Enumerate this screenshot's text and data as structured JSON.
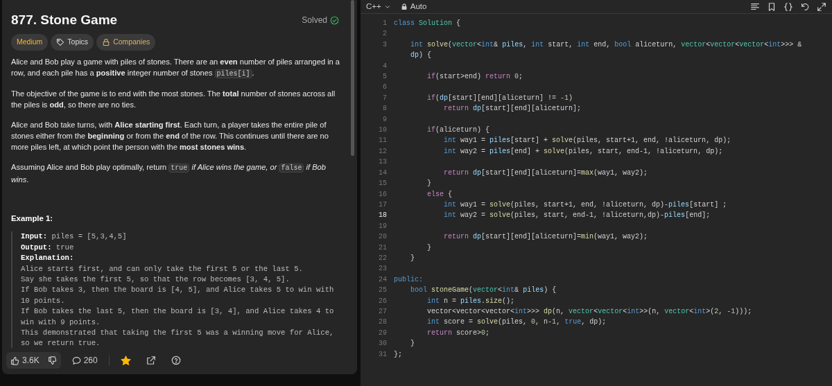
{
  "problem": {
    "title": "877. Stone Game",
    "status": "Solved",
    "solved": true,
    "tags": [
      {
        "label": "Medium",
        "kind": "difficulty"
      },
      {
        "label": "Topics",
        "kind": "topics"
      },
      {
        "label": "Companies",
        "kind": "companies"
      }
    ],
    "paragraphs": [
      [
        {
          "kind": "text",
          "text": "Alice and Bob play a game with piles of stones. There are an **even** number of piles arranged in a row, and each pile has a **positive** integer number of stones "
        },
        {
          "kind": "code",
          "text": "piles[i]"
        },
        {
          "kind": "text",
          "text": "."
        }
      ],
      [
        {
          "kind": "text",
          "text": "The objective of the game is to end with the most stones. The **total** number of stones across all the piles is **odd**, so there are no ties."
        }
      ],
      [
        {
          "kind": "text",
          "text": "Alice and Bob take turns, with **Alice starting first**. Each turn, a player takes the entire pile of stones either from the **beginning** or from the **end** of the row. This continues until there are no more piles left, at which point the person with the **most stones wins**."
        }
      ],
      [
        {
          "kind": "text",
          "text": "Assuming Alice and Bob play optimally, return "
        },
        {
          "kind": "code",
          "text": "true"
        },
        {
          "kind": "text",
          "text": " *if Alice wins the game, or* "
        },
        {
          "kind": "code",
          "text": "false"
        },
        {
          "kind": "text",
          "text": " *if Bob wins*."
        }
      ]
    ],
    "example": {
      "title": "Example 1:",
      "fields": [
        {
          "label": "Input:",
          "value": "piles = [5,3,4,5]"
        },
        {
          "label": "Output:",
          "value": "true"
        }
      ],
      "explanation_label": "Explanation:",
      "explanation_lines": [
        "Alice starts first, and can only take the first 5 or the last 5.",
        "Say she takes the first 5, so that the row becomes [3, 4, 5].",
        "If Bob takes 3, then the board is [4, 5], and Alice takes 5 to win with 10 points.",
        "If Bob takes the last 5, then the board is [3, 4], and Alice takes 4 to win with 9 points.",
        "This demonstrated that taking the first 5 was a winning move for Alice, so we return true."
      ]
    },
    "actions": {
      "likes": "3.6K",
      "comments": "260",
      "favorited": true
    }
  },
  "editor": {
    "language": "C++",
    "mode": "Auto",
    "lines": [
      {
        "no": "1",
        "active": false,
        "segs": [
          {
            "kind": "keyword",
            "text": "class "
          },
          {
            "kind": "type",
            "text": "Solution"
          },
          {
            "kind": "plain",
            "text": " {"
          }
        ]
      },
      {
        "no": "2",
        "active": false
      },
      {
        "no": "3",
        "active": false,
        "segs": [
          {
            "kind": "keyword",
            "text": "    int "
          },
          {
            "kind": "function",
            "text": "solve"
          },
          {
            "kind": "plain",
            "text": "("
          },
          {
            "kind": "type",
            "text": "vector"
          },
          {
            "kind": "plain",
            "text": "<"
          },
          {
            "kind": "keyword",
            "text": "int"
          },
          {
            "kind": "plain",
            "text": "& "
          },
          {
            "kind": "variable",
            "text": "piles"
          },
          {
            "kind": "plain",
            "text": ", "
          },
          {
            "kind": "keyword",
            "text": "int"
          },
          {
            "kind": "plain",
            "text": " start, "
          },
          {
            "kind": "keyword",
            "text": "int"
          },
          {
            "kind": "plain",
            "text": " end, "
          },
          {
            "kind": "keyword",
            "text": "bool"
          },
          {
            "kind": "plain",
            "text": " aliceturn, "
          },
          {
            "kind": "type",
            "text": "vector"
          },
          {
            "kind": "plain",
            "text": "<"
          },
          {
            "kind": "type",
            "text": "vector"
          },
          {
            "kind": "plain",
            "text": "<"
          },
          {
            "kind": "type",
            "text": "vector"
          },
          {
            "kind": "plain",
            "text": "<"
          },
          {
            "kind": "keyword",
            "text": "int"
          },
          {
            "kind": "plain",
            "text": ">>> & "
          },
          {
            "kind": "variable",
            "text": "dp"
          },
          {
            "kind": "plain",
            "text": ") {"
          }
        ]
      },
      {
        "no": "4",
        "active": false
      },
      {
        "no": "5",
        "active": false,
        "segs": [
          {
            "kind": "control",
            "text": "        if"
          },
          {
            "kind": "plain",
            "text": "(start>end) "
          },
          {
            "kind": "control",
            "text": "return "
          },
          {
            "kind": "number",
            "text": "0"
          },
          {
            "kind": "plain",
            "text": ";"
          }
        ]
      },
      {
        "no": "6",
        "active": false
      },
      {
        "no": "7",
        "active": false,
        "segs": [
          {
            "kind": "control",
            "text": "        if"
          },
          {
            "kind": "plain",
            "text": "("
          },
          {
            "kind": "variable",
            "text": "dp"
          },
          {
            "kind": "plain",
            "text": "[start][end][aliceturn] != "
          },
          {
            "kind": "number",
            "text": "-1"
          },
          {
            "kind": "plain",
            "text": ")"
          }
        ]
      },
      {
        "no": "8",
        "active": false,
        "segs": [
          {
            "kind": "control",
            "text": "            return "
          },
          {
            "kind": "variable",
            "text": "dp"
          },
          {
            "kind": "plain",
            "text": "[start][end][aliceturn];"
          }
        ]
      },
      {
        "no": "9",
        "active": false
      },
      {
        "no": "10",
        "active": false,
        "segs": [
          {
            "kind": "control",
            "text": "        if"
          },
          {
            "kind": "plain",
            "text": "(aliceturn) {"
          }
        ]
      },
      {
        "no": "11",
        "active": false,
        "segs": [
          {
            "kind": "keyword",
            "text": "            int"
          },
          {
            "kind": "plain",
            "text": " way1 = "
          },
          {
            "kind": "variable",
            "text": "piles"
          },
          {
            "kind": "plain",
            "text": "[start] + "
          },
          {
            "kind": "function",
            "text": "solve"
          },
          {
            "kind": "plain",
            "text": "(piles, start+1, end, !aliceturn, dp);"
          }
        ]
      },
      {
        "no": "12",
        "active": false,
        "segs": [
          {
            "kind": "keyword",
            "text": "            int"
          },
          {
            "kind": "plain",
            "text": " way2 = "
          },
          {
            "kind": "variable",
            "text": "piles"
          },
          {
            "kind": "plain",
            "text": "[end] + "
          },
          {
            "kind": "function",
            "text": "solve"
          },
          {
            "kind": "plain",
            "text": "(piles, start, end-1, !aliceturn, dp);"
          }
        ]
      },
      {
        "no": "13",
        "active": false
      },
      {
        "no": "14",
        "active": false,
        "segs": [
          {
            "kind": "control",
            "text": "            return "
          },
          {
            "kind": "variable",
            "text": "dp"
          },
          {
            "kind": "plain",
            "text": "[start][end][aliceturn]="
          },
          {
            "kind": "function",
            "text": "max"
          },
          {
            "kind": "plain",
            "text": "(way1, way2);"
          }
        ]
      },
      {
        "no": "15",
        "active": false,
        "segs": [
          {
            "kind": "plain",
            "text": "        }"
          }
        ]
      },
      {
        "no": "16",
        "active": false,
        "segs": [
          {
            "kind": "control",
            "text": "        else"
          },
          {
            "kind": "plain",
            "text": " {"
          }
        ]
      },
      {
        "no": "17",
        "active": false,
        "segs": [
          {
            "kind": "keyword",
            "text": "            int"
          },
          {
            "kind": "plain",
            "text": " way1 = "
          },
          {
            "kind": "function",
            "text": "solve"
          },
          {
            "kind": "plain",
            "text": "(piles, start+1, end, !aliceturn, dp)-"
          },
          {
            "kind": "variable",
            "text": "piles"
          },
          {
            "kind": "plain",
            "text": "[start] ;"
          }
        ]
      },
      {
        "no": "18",
        "active": true,
        "segs": [
          {
            "kind": "keyword",
            "text": "            int"
          },
          {
            "kind": "plain",
            "text": " way2 = "
          },
          {
            "kind": "function",
            "text": "solve"
          },
          {
            "kind": "plain",
            "text": "(piles, start, end-1, !aliceturn,dp)-"
          },
          {
            "kind": "variable",
            "text": "piles"
          },
          {
            "kind": "plain",
            "text": "[end];"
          }
        ]
      },
      {
        "no": "19",
        "active": false
      },
      {
        "no": "20",
        "active": false,
        "segs": [
          {
            "kind": "control",
            "text": "            return "
          },
          {
            "kind": "variable",
            "text": "dp"
          },
          {
            "kind": "plain",
            "text": "[start][end][aliceturn]="
          },
          {
            "kind": "function",
            "text": "min"
          },
          {
            "kind": "plain",
            "text": "(way1, way2);"
          }
        ]
      },
      {
        "no": "21",
        "active": false,
        "segs": [
          {
            "kind": "plain",
            "text": "        }"
          }
        ]
      },
      {
        "no": "22",
        "active": false,
        "segs": [
          {
            "kind": "plain",
            "text": "    }"
          }
        ]
      },
      {
        "no": "23",
        "active": false
      },
      {
        "no": "24",
        "active": false,
        "segs": [
          {
            "kind": "keyword",
            "text": "public:"
          }
        ]
      },
      {
        "no": "25",
        "active": false,
        "segs": [
          {
            "kind": "keyword",
            "text": "    bool "
          },
          {
            "kind": "function",
            "text": "stoneGame"
          },
          {
            "kind": "plain",
            "text": "("
          },
          {
            "kind": "type",
            "text": "vector"
          },
          {
            "kind": "plain",
            "text": "<"
          },
          {
            "kind": "keyword",
            "text": "int"
          },
          {
            "kind": "plain",
            "text": "& "
          },
          {
            "kind": "variable",
            "text": "piles"
          },
          {
            "kind": "plain",
            "text": ") {"
          }
        ]
      },
      {
        "no": "26",
        "active": false,
        "segs": [
          {
            "kind": "keyword",
            "text": "        int"
          },
          {
            "kind": "plain",
            "text": " n = "
          },
          {
            "kind": "variable",
            "text": "piles"
          },
          {
            "kind": "plain",
            "text": "."
          },
          {
            "kind": "function",
            "text": "size"
          },
          {
            "kind": "plain",
            "text": "();"
          }
        ]
      },
      {
        "no": "27",
        "active": false,
        "segs": [
          {
            "kind": "plain",
            "text": "        vector<vector<vector<"
          },
          {
            "kind": "keyword",
            "text": "int"
          },
          {
            "kind": "plain",
            "text": ">>> "
          },
          {
            "kind": "function",
            "text": "dp"
          },
          {
            "kind": "plain",
            "text": "(n, "
          },
          {
            "kind": "type",
            "text": "vector"
          },
          {
            "kind": "plain",
            "text": "<"
          },
          {
            "kind": "type",
            "text": "vector"
          },
          {
            "kind": "plain",
            "text": "<"
          },
          {
            "kind": "keyword",
            "text": "int"
          },
          {
            "kind": "plain",
            "text": ">>(n, "
          },
          {
            "kind": "type",
            "text": "vector"
          },
          {
            "kind": "plain",
            "text": "<"
          },
          {
            "kind": "keyword",
            "text": "int"
          },
          {
            "kind": "plain",
            "text": ">("
          },
          {
            "kind": "number",
            "text": "2"
          },
          {
            "kind": "plain",
            "text": ", "
          },
          {
            "kind": "number",
            "text": "-1"
          },
          {
            "kind": "plain",
            "text": ")));"
          }
        ]
      },
      {
        "no": "28",
        "active": false,
        "segs": [
          {
            "kind": "keyword",
            "text": "        int"
          },
          {
            "kind": "plain",
            "text": " score = "
          },
          {
            "kind": "function",
            "text": "solve"
          },
          {
            "kind": "plain",
            "text": "(piles, "
          },
          {
            "kind": "number",
            "text": "0"
          },
          {
            "kind": "plain",
            "text": ", n-"
          },
          {
            "kind": "number",
            "text": "1"
          },
          {
            "kind": "plain",
            "text": ", "
          },
          {
            "kind": "keyword",
            "text": "true"
          },
          {
            "kind": "plain",
            "text": ", dp);"
          }
        ]
      },
      {
        "no": "29",
        "active": false,
        "segs": [
          {
            "kind": "control",
            "text": "        return"
          },
          {
            "kind": "plain",
            "text": " score>"
          },
          {
            "kind": "number",
            "text": "0"
          },
          {
            "kind": "plain",
            "text": ";"
          }
        ]
      },
      {
        "no": "30",
        "active": false,
        "segs": [
          {
            "kind": "plain",
            "text": "    }"
          }
        ]
      },
      {
        "no": "31",
        "active": false,
        "segs": [
          {
            "kind": "plain",
            "text": "};"
          }
        ]
      }
    ]
  }
}
